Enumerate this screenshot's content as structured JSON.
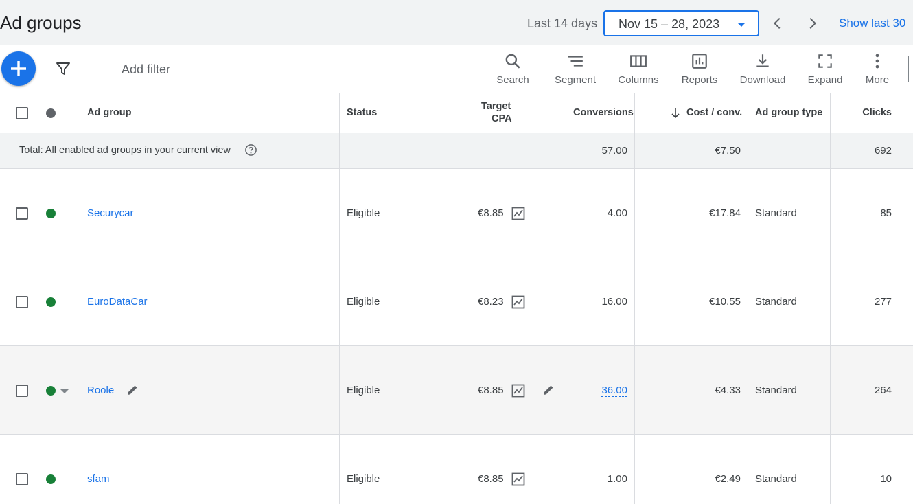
{
  "header": {
    "title": "Ad groups",
    "range_label": "Last 14 days",
    "date_range": "Nov 15 – 28, 2023",
    "show_last": "Show last 30"
  },
  "toolbar": {
    "add_filter": "Add filter",
    "tools": [
      {
        "label": "Search",
        "icon": "search-icon"
      },
      {
        "label": "Segment",
        "icon": "segment-icon"
      },
      {
        "label": "Columns",
        "icon": "columns-icon"
      },
      {
        "label": "Reports",
        "icon": "reports-icon"
      },
      {
        "label": "Download",
        "icon": "download-icon"
      },
      {
        "label": "Expand",
        "icon": "expand-icon"
      },
      {
        "label": "More",
        "icon": "more-vert-icon"
      }
    ]
  },
  "table": {
    "columns": {
      "ad_group": "Ad group",
      "status": "Status",
      "target_cpa_1": "Target",
      "target_cpa_2": "CPA",
      "conversions": "Conversions",
      "cost_conv": "Cost / conv.",
      "ad_group_type": "Ad group type",
      "clicks": "Clicks"
    },
    "total": {
      "label": "Total: All enabled ad groups in your current view",
      "conversions": "57.00",
      "cost_conv": "€7.50",
      "clicks": "692"
    },
    "rows": [
      {
        "name": "Securycar",
        "status": "Eligible",
        "target_cpa": "€8.85",
        "conversions": "4.00",
        "cost_conv": "€17.84",
        "type": "Standard",
        "clicks": "85"
      },
      {
        "name": "EuroDataCar",
        "status": "Eligible",
        "target_cpa": "€8.23",
        "conversions": "16.00",
        "cost_conv": "€10.55",
        "type": "Standard",
        "clicks": "277"
      },
      {
        "name": "Roole",
        "status": "Eligible",
        "target_cpa": "€8.85",
        "conversions": "36.00",
        "cost_conv": "€4.33",
        "type": "Standard",
        "clicks": "264"
      },
      {
        "name": "sfam",
        "status": "Eligible",
        "target_cpa": "€8.85",
        "conversions": "1.00",
        "cost_conv": "€2.49",
        "type": "Standard",
        "clicks": "10"
      }
    ]
  },
  "colors": {
    "accent": "#1a73e8",
    "enabled_status": "#188038",
    "header_status_dot": "#5f6368"
  }
}
